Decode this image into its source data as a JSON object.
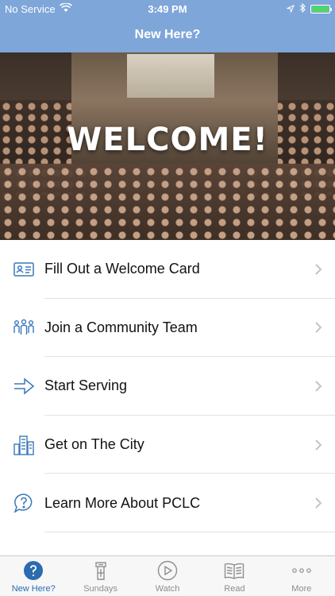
{
  "status_bar": {
    "carrier": "No Service",
    "time": "3:49 PM"
  },
  "nav": {
    "title": "New Here?"
  },
  "hero": {
    "headline": "WELCOME!"
  },
  "menu": {
    "items": [
      {
        "label": "Fill Out a Welcome Card",
        "icon": "id-card-icon"
      },
      {
        "label": "Join a Community Team",
        "icon": "people-group-icon"
      },
      {
        "label": "Start Serving",
        "icon": "arrow-right-icon"
      },
      {
        "label": "Get on The City",
        "icon": "city-buildings-icon"
      },
      {
        "label": "Learn More About PCLC",
        "icon": "question-bubble-icon"
      }
    ]
  },
  "tabbar": {
    "tabs": [
      {
        "label": "New Here?",
        "icon": "question-circle-icon",
        "active": true
      },
      {
        "label": "Sundays",
        "icon": "pulpit-icon",
        "active": false
      },
      {
        "label": "Watch",
        "icon": "play-circle-icon",
        "active": false
      },
      {
        "label": "Read",
        "icon": "book-icon",
        "active": false
      },
      {
        "label": "More",
        "icon": "more-dots-icon",
        "active": false
      }
    ]
  },
  "colors": {
    "nav_bg": "#7ea6d8",
    "accent": "#2b6cb0",
    "icon_blue": "#3a79b8",
    "tab_inactive": "#8e8e8e"
  }
}
